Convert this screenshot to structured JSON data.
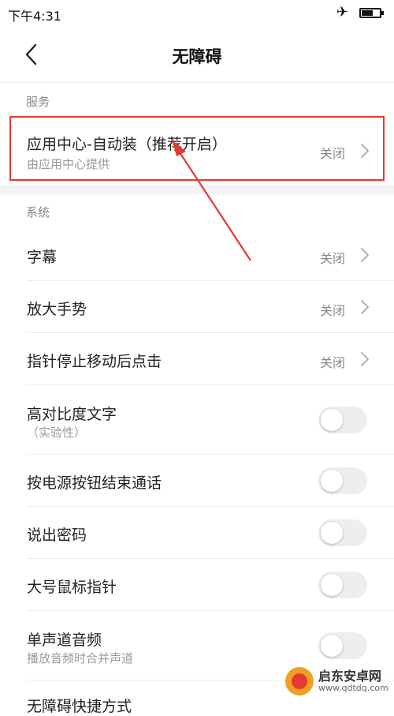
{
  "status": {
    "time": "下午4:31"
  },
  "header": {
    "title": "无障碍"
  },
  "sections": {
    "services": "服务",
    "system": "系统"
  },
  "service_item": {
    "label": "应用中心-自动装（推荐开启）",
    "sub": "由应用中心提供",
    "value": "关闭"
  },
  "system_items": [
    {
      "label": "字幕",
      "value": "关闭"
    },
    {
      "label": "放大手势",
      "value": "关闭"
    },
    {
      "label": "指针停止移动后点击",
      "value": "关闭"
    },
    {
      "label": "高对比度文字",
      "sub": "（实验性）",
      "toggle": false
    },
    {
      "label": "按电源按钮结束通话",
      "toggle": false
    },
    {
      "label": "说出密码",
      "toggle": false
    },
    {
      "label": "大号鼠标指针",
      "toggle": false
    },
    {
      "label": "单声道音频",
      "sub": "播放音频时合并声道",
      "toggle": false
    },
    {
      "label": "无障碍快捷方式"
    }
  ],
  "watermark": {
    "name": "启东安卓网",
    "url": "www.qdtdq.com"
  },
  "colors": {
    "highlight": "#e53935",
    "toggle_off": "#eeeeee"
  }
}
